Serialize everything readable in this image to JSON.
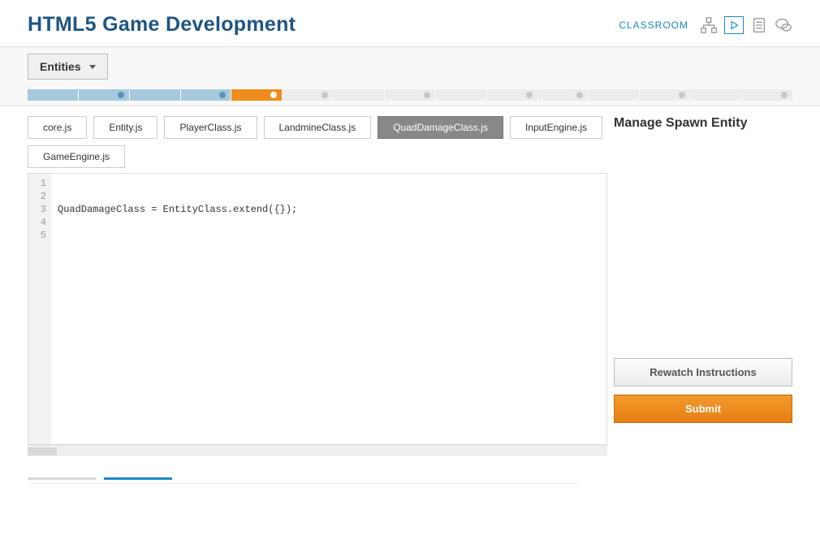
{
  "header": {
    "title": "HTML5 Game Development",
    "classroom": "CLASSROOM"
  },
  "dropdown": {
    "label": "Entities"
  },
  "progress": [
    {
      "state": "done",
      "dot": false
    },
    {
      "state": "done",
      "dot": true
    },
    {
      "state": "done",
      "dot": false
    },
    {
      "state": "done",
      "dot": true
    },
    {
      "state": "current",
      "dot": true
    },
    {
      "state": "todo",
      "dot": true
    },
    {
      "state": "todo",
      "dot": false
    },
    {
      "state": "todo",
      "dot": true
    },
    {
      "state": "todo",
      "dot": false
    },
    {
      "state": "todo",
      "dot": true
    },
    {
      "state": "todo",
      "dot": true
    },
    {
      "state": "todo",
      "dot": false
    },
    {
      "state": "todo",
      "dot": true
    },
    {
      "state": "todo",
      "dot": false
    },
    {
      "state": "todo",
      "dot": true
    }
  ],
  "tabs": [
    {
      "label": "core.js",
      "active": false
    },
    {
      "label": "Entity.js",
      "active": false
    },
    {
      "label": "PlayerClass.js",
      "active": false
    },
    {
      "label": "LandmineClass.js",
      "active": false
    },
    {
      "label": "QuadDamageClass.js",
      "active": true
    },
    {
      "label": "InputEngine.js",
      "active": false
    },
    {
      "label": "GameEngine.js",
      "active": false
    }
  ],
  "editor": {
    "lines": [
      "",
      "",
      "QuadDamageClass = EntityClass.extend({});",
      "",
      ""
    ]
  },
  "sidebar": {
    "title": "Manage Spawn Entity",
    "rewatch": "Rewatch Instructions",
    "submit": "Submit"
  }
}
